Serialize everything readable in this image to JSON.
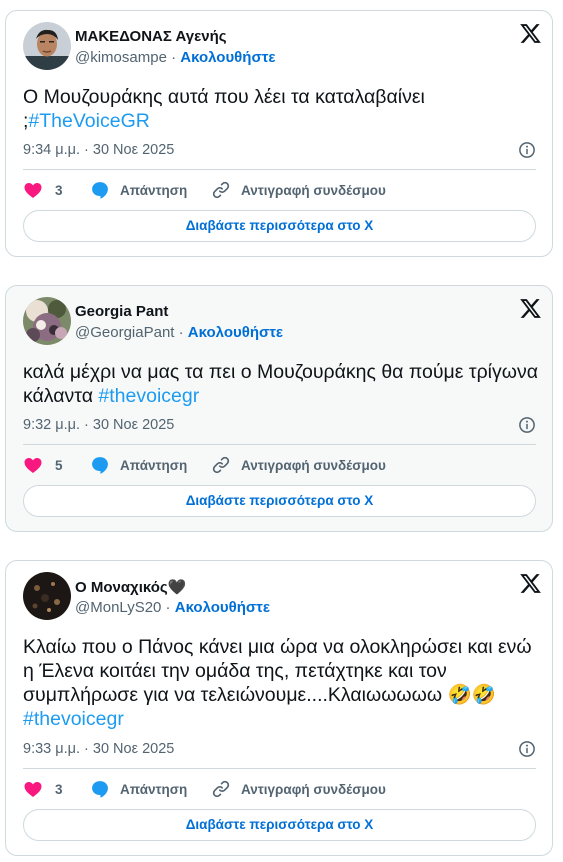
{
  "tweets": [
    {
      "name": "ΜΑΚΕΔΟΝΑΣ Αγενής",
      "name_suffix": "",
      "handle": "@kimosampe",
      "separator": " · ",
      "follow": "Ακολουθήστε",
      "text": "Ο Μουζουράκης αυτά που λέει τα καταλαβαίνει ;",
      "hashtag": "#TheVoiceGR",
      "time": "9:34 μ.μ. · 30 Νοε 2025",
      "likes": "3",
      "reply": "Απάντηση",
      "copy_link": "Αντιγραφή συνδέσμου",
      "read_more": "Διαβάστε περισσότερα στο X"
    },
    {
      "name": "Georgia Pant",
      "name_suffix": "",
      "handle": "@GeorgiaPant",
      "separator": " · ",
      "follow": "Ακολουθήστε",
      "text": "καλά μέχρι να μας τα πει ο Μουζουράκης θα πούμε τρίγωνα κάλαντα ",
      "hashtag": "#thevoicegr",
      "time": "9:32 μ.μ. · 30 Νοε 2025",
      "likes": "5",
      "reply": "Απάντηση",
      "copy_link": "Αντιγραφή συνδέσμου",
      "read_more": "Διαβάστε περισσότερα στο X"
    },
    {
      "name": "Ο Μοναχικός",
      "name_suffix": "🖤",
      "handle": "@MonLyS20",
      "separator": " · ",
      "follow": "Ακολουθήστε",
      "text": "Κλαίω που ο Πάνος κάνει μια ώρα να ολοκληρώσει και ενώ η Έλενα κοιτάει την ομάδα της, πετάχτηκε και τον συμπλήρωσε για να τελειώνουμε....Κλαιωωωωω 🤣🤣",
      "hashtag": "#thevoicegr",
      "time": "9:33 μ.μ. · 30 Νοε 2025",
      "likes": "3",
      "reply": "Απάντηση",
      "copy_link": "Αντιγραφή συνδέσμου",
      "read_more": "Διαβάστε περισσότερα στο X"
    }
  ],
  "colors": {
    "accent": "#006fd6",
    "hashtag": "#1d9bf0",
    "heart": "#f91880",
    "reply": "#1d9bf0",
    "border": "#cfd9de",
    "muted": "#536471"
  },
  "icons": [
    "x-logo-icon",
    "info-icon",
    "heart-icon",
    "reply-bubble-icon",
    "link-icon"
  ]
}
